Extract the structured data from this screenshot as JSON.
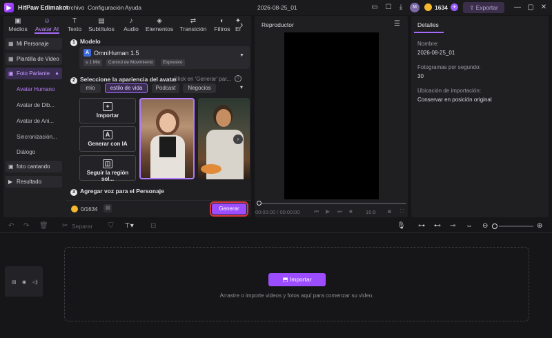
{
  "titlebar": {
    "app_name": "HitPaw Edimakor",
    "menus": [
      "Archivo",
      "Configuración",
      "Ayuda"
    ],
    "project_title": "2026-08-25_01",
    "credits": "1634",
    "export_label": "Exportar",
    "user_initial": "M"
  },
  "top_tabs": [
    {
      "label": "Medios",
      "icon": "media-icon"
    },
    {
      "label": "Avatar AI",
      "icon": "avatar-ai-icon"
    },
    {
      "label": "Texto",
      "icon": "text-icon"
    },
    {
      "label": "Subtítulos",
      "icon": "subtitles-icon"
    },
    {
      "label": "Audio",
      "icon": "audio-icon"
    },
    {
      "label": "Elementos",
      "icon": "elements-icon"
    },
    {
      "label": "Transición",
      "icon": "transition-icon"
    },
    {
      "label": "Filtros",
      "icon": "filters-icon"
    },
    {
      "label": "Ef",
      "icon": "effects-icon"
    }
  ],
  "side_nav": {
    "items": [
      "Mi Personaje",
      "Plantilla de Video",
      "Foto Parlante"
    ],
    "sub_items": [
      "Avatar Humano",
      "Avatar de Dib...",
      "Avatar de Ani...",
      "Sincronización...",
      "Diálogo"
    ],
    "bottom_items": [
      "foto cantando",
      "Resultado"
    ]
  },
  "model": {
    "section_title": "Modelo",
    "name": "OmniHuman 1.5",
    "tags": [
      "≤ 1 Min",
      "Control de Movimiento",
      "Expresivo"
    ]
  },
  "appearance": {
    "section_title": "Seleccione la apariencia del avatar",
    "hint": "Click en 'Generar' par...",
    "chips": [
      "mío",
      "estilo de vida",
      "Podcast",
      "Negocios"
    ]
  },
  "actions": [
    "Importar",
    "Generar con IA",
    "Seguir la región sol..."
  ],
  "voice": {
    "section_title": "Agregar voz para el Personaje"
  },
  "generate": {
    "count": "0/1634",
    "button_label": "Generar"
  },
  "player": {
    "title": "Reproductor",
    "time": "00:00:00 / 00:00:00",
    "ratio": "16:9"
  },
  "details": {
    "tab": "Detalles",
    "fields": [
      {
        "label": "Nombre:",
        "value": "2026-08-25_01"
      },
      {
        "label": "Fotogramas por segundo:",
        "value": "30"
      },
      {
        "label": "Ubicación de importación:",
        "value": "Conservar en posición original"
      }
    ]
  },
  "timeline": {
    "split_label": "Separar",
    "import_label": "Importar",
    "drop_hint": "Arrastre o importe videos y fotos aquí para comenzar su video."
  },
  "colors": {
    "accent": "#9b4dff",
    "highlight_outline": "#e0383e",
    "background": "#161618"
  }
}
